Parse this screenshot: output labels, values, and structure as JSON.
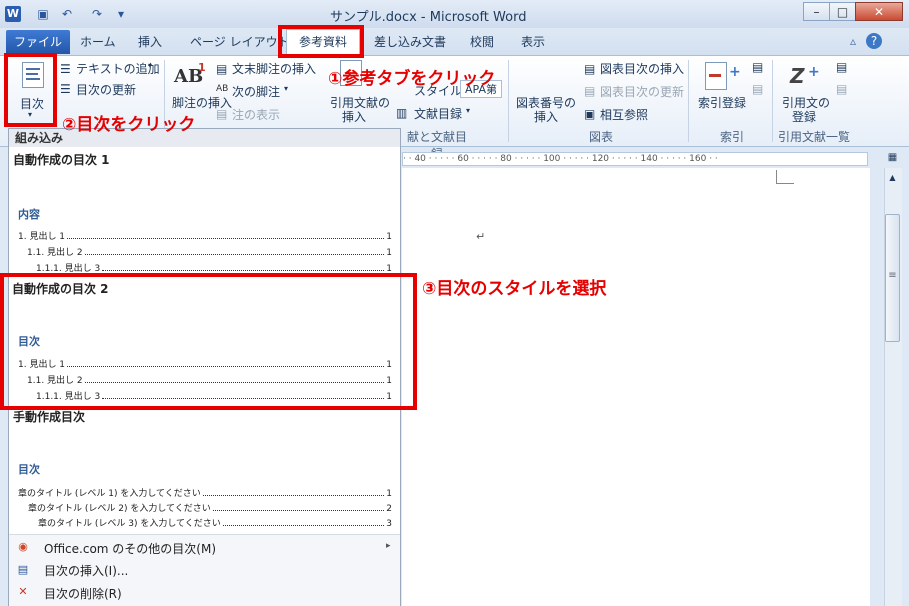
{
  "app": {
    "icon_letter": "W",
    "title": "サンプル.docx - Microsoft Word",
    "window_controls": [
      "–",
      "□",
      "✕"
    ]
  },
  "quick_access": {
    "save_icon": "save-icon",
    "undo_icon": "undo-icon",
    "redo_icon": "redo-icon"
  },
  "tabs": {
    "file": "ファイル",
    "home": "ホーム",
    "insert": "挿入",
    "page_layout": "ページ レイアウト",
    "references": "参考資料",
    "mailings": "差し込み文書",
    "review": "校閲",
    "view": "表示"
  },
  "ribbon": {
    "toc": {
      "toc_button": "目次",
      "add_text": "テキストの追加",
      "update_toc": "目次の更新",
      "group_label": ""
    },
    "footnotes": {
      "insert_footnote": "脚注の挿入",
      "endnote": "文末脚注の挿入",
      "next_footnote": "次の脚注",
      "show_notes": "注の表示",
      "ab_icon": "AB",
      "ab_sup": "1"
    },
    "citations": {
      "insert_citation_line1": "引用文献の",
      "insert_citation_line2": "挿入",
      "style_label": "スタイル:",
      "style_value": "APA第",
      "bibliography": "文献目録",
      "group_label_partial": "献と文献目録"
    },
    "captions": {
      "insert_caption_line1": "図表番号の",
      "insert_caption_line2": "挿入",
      "insert_table_of_figures": "図表目次の挿入",
      "update_table": "図表目次の更新",
      "cross_reference": "相互参照",
      "group_label": "図表"
    },
    "index": {
      "mark_entry": "索引登録",
      "group_label": "索引"
    },
    "toa": {
      "mark_citation_line1": "引用文の",
      "mark_citation_line2": "登録",
      "group_label": "引用文献一覧"
    }
  },
  "ruler": {
    "text": "· · 40 · · · · · 60 · · · · · 80 · · · · · 100 · · · · · 120 · · · · · 140 · · · · · 160 · ·"
  },
  "document": {
    "paragraph_mark": "↵"
  },
  "gallery": {
    "header": "組み込み",
    "auto1": {
      "title": "自動作成の目次 1",
      "heading": "内容",
      "rows": [
        {
          "label": "1.  見出し  1",
          "page": "1"
        },
        {
          "label": "1.1.  見出し  2",
          "page": "1"
        },
        {
          "label": "1.1.1.  見出し  3",
          "page": "1"
        }
      ]
    },
    "auto2": {
      "title": "自動作成の目次 2",
      "heading": "目次",
      "rows": [
        {
          "label": "1.  見出し  1",
          "page": "1"
        },
        {
          "label": "1.1.  見出し  2",
          "page": "1"
        },
        {
          "label": "1.1.1.  見出し  3",
          "page": "1"
        }
      ]
    },
    "manual": {
      "title": "手動作成目次",
      "heading": "目次",
      "rows": [
        {
          "label": "章のタイトル (レベル 1) を入力してください",
          "page": "1"
        },
        {
          "label": "章のタイトル (レベル 2) を入力してください",
          "page": "2"
        },
        {
          "label": "章のタイトル (レベル 3) を入力してください",
          "page": "3"
        }
      ]
    },
    "menu": {
      "more_online": "Office.com のその他の目次(M)",
      "insert_toc": "目次の挿入(I)...",
      "remove_toc": "目次の削除(R)"
    }
  },
  "annotations": {
    "step1": "①参考タブをクリック",
    "step2": "②目次をクリック",
    "step3": "③目次のスタイルを選択",
    "color": "#e60000"
  }
}
